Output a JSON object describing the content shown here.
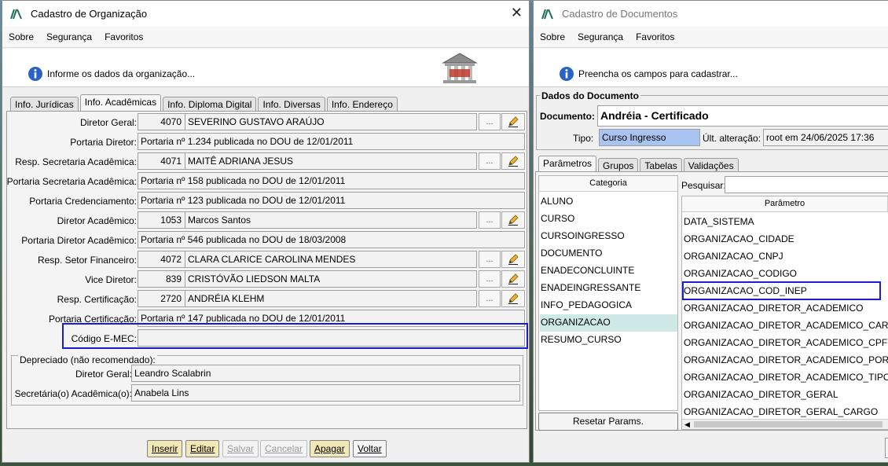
{
  "left_window": {
    "title": "Cadastro de Organização",
    "close_label": "✕",
    "menu": [
      "Sobre",
      "Segurança",
      "Favoritos"
    ],
    "banner_text": "Informe os dados da organização...",
    "tabs": [
      "Info. Jurídicas",
      "Info. Acadêmicas",
      "Info. Diploma Digital",
      "Info. Diversas",
      "Info. Endereço"
    ],
    "active_tab": "Info. Acadêmicas",
    "fields": {
      "diretor_geral": {
        "label": "Diretor Geral:",
        "code": "4070",
        "value": "SEVERINO GUSTAVO ARAÚJO"
      },
      "portaria_diretor": {
        "label": "Portaria Diretor:",
        "value": "Portaria nº 1.234 publicada no DOU de 12/01/2011"
      },
      "resp_secretaria": {
        "label": "Resp. Secretaria Acadêmica:",
        "code": "4071",
        "value": "MAITÊ ADRIANA JESUS"
      },
      "portaria_secretaria": {
        "label": "Portaria Secretaria Acadêmica:",
        "value": "Portaria nº 158 publicada no DOU de 12/01/2011"
      },
      "portaria_credenciamento": {
        "label": "Portaria Credenciamento:",
        "value": "Portaria nº 123 publicada no DOU de 12/01/2011"
      },
      "diretor_academico": {
        "label": "Diretor Acadêmico:",
        "code": "1053",
        "value": "Marcos Santos"
      },
      "portaria_diretor_academico": {
        "label": "Portaria Diretor Acadêmico:",
        "value": "Portaria nº 546 publicada no DOU de 18/03/2008"
      },
      "resp_setor_financeiro": {
        "label": "Resp. Setor Financeiro:",
        "code": "4072",
        "value": "CLARA CLARICE CAROLINA MENDES"
      },
      "vice_diretor": {
        "label": "Vice Diretor:",
        "code": "839",
        "value": "CRISTÓVÃO LIEDSON MALTA"
      },
      "resp_certificacao": {
        "label": "Resp. Certificação:",
        "code": "2720",
        "value": "ANDRÉIA KLEHM"
      },
      "portaria_certificacao": {
        "label": "Portaria Certificação:",
        "value": "Portaria nº 147 publicada no DOU de 12/01/2011"
      },
      "codigo_emec": {
        "label": "Código E-MEC:",
        "value": ""
      }
    },
    "dots_label": "...",
    "depreciado": {
      "title": "Depreciado (não recomendado):",
      "diretor_geral_label": "Diretor Geral:",
      "diretor_geral_value": "Leandro Scalabrin",
      "secretaria_label": "Secretária(o) Acadêmica(o):",
      "secretaria_value": "Anabela Lins"
    },
    "buttons": {
      "inserir": "Inserir",
      "editar": "Editar",
      "salvar": "Salvar",
      "cancelar": "Cancelar",
      "apagar": "Apagar",
      "voltar": "Voltar"
    }
  },
  "right_window": {
    "title": "Cadastro de Documentos",
    "menu": [
      "Sobre",
      "Segurança",
      "Favoritos"
    ],
    "banner_text": "Preencha os campos para cadastrar...",
    "dados_title": "Dados do Documento",
    "documento_label": "Documento:",
    "documento_value": "Andréia - Certificado",
    "tipo_label": "Tipo:",
    "tipo_value": "Curso Ingresso",
    "ult_alteracao_label": "Últ. alteração:",
    "ult_alteracao_value": "root em 24/06/2025 17:36",
    "tabs": [
      "Parâmetros",
      "Grupos",
      "Tabelas",
      "Validações"
    ],
    "active_tab": "Parâmetros",
    "categoria_header": "Categoria",
    "categorias": [
      "ALUNO",
      "CURSO",
      "CURSOINGRESSO",
      "DOCUMENTO",
      "ENADECONCLUINTE",
      "ENADEINGRESSANTE",
      "INFO_PEDAGOGICA",
      "ORGANIZACAO",
      "RESUMO_CURSO"
    ],
    "selected_categoria": "ORGANIZACAO",
    "resetar_label": "Resetar Params.",
    "pesquisar_label": "Pesquisar:",
    "pesquisar_value": "",
    "parametro_header": "Parâmetro",
    "parametros": [
      "DATA_SISTEMA",
      "ORGANIZACAO_CIDADE",
      "ORGANIZACAO_CNPJ",
      "ORGANIZACAO_CODIGO",
      "ORGANIZACAO_COD_INEP",
      "ORGANIZACAO_DIRETOR_ACADEMICO",
      "ORGANIZACAO_DIRETOR_ACADEMICO_CARGO",
      "ORGANIZACAO_DIRETOR_ACADEMICO_CPF",
      "ORGANIZACAO_DIRETOR_ACADEMICO_PORT...",
      "ORGANIZACAO_DIRETOR_ACADEMICO_TIPO_...",
      "ORGANIZACAO_DIRETOR_GERAL",
      "ORGANIZACAO_DIRETOR_GERAL_CARGO"
    ],
    "highlighted_parametro": "ORGANIZACAO_COD_INEP"
  },
  "colors": {
    "highlight": "#1b1bd0",
    "selection": "#cfe8e8",
    "tipo_bg": "#a9c4f0",
    "button_yellow": "#f2e8b5"
  },
  "icons": [
    "app-logo-icon",
    "info-icon",
    "building-icon",
    "pencil-icon",
    "close-icon"
  ]
}
